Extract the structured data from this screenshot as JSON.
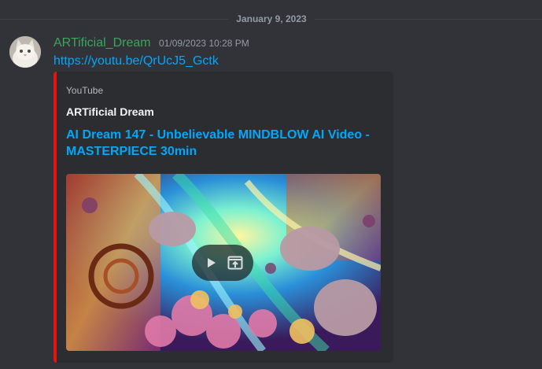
{
  "divider": {
    "date": "January 9, 2023"
  },
  "message": {
    "author": "ARTificial_Dream",
    "timestamp": "01/09/2023 10:28 PM",
    "link": "https://youtu.be/QrUcJ5_Gctk",
    "avatar_icon": "cat-avatar"
  },
  "embed": {
    "provider": "YouTube",
    "author": "ARTificial Dream",
    "title": "AI Dream 147 - Unbelievable MINDBLOW AI Video - MASTERPIECE 30min",
    "accent_color": "#e5140e",
    "thumbnail_icon": "video-thumbnail",
    "controls": [
      "play-icon",
      "open-external-icon"
    ]
  },
  "colors": {
    "background": "#313338",
    "embed_background": "#2b2d31",
    "username": "#3ba55c",
    "link": "#00a8fc"
  }
}
